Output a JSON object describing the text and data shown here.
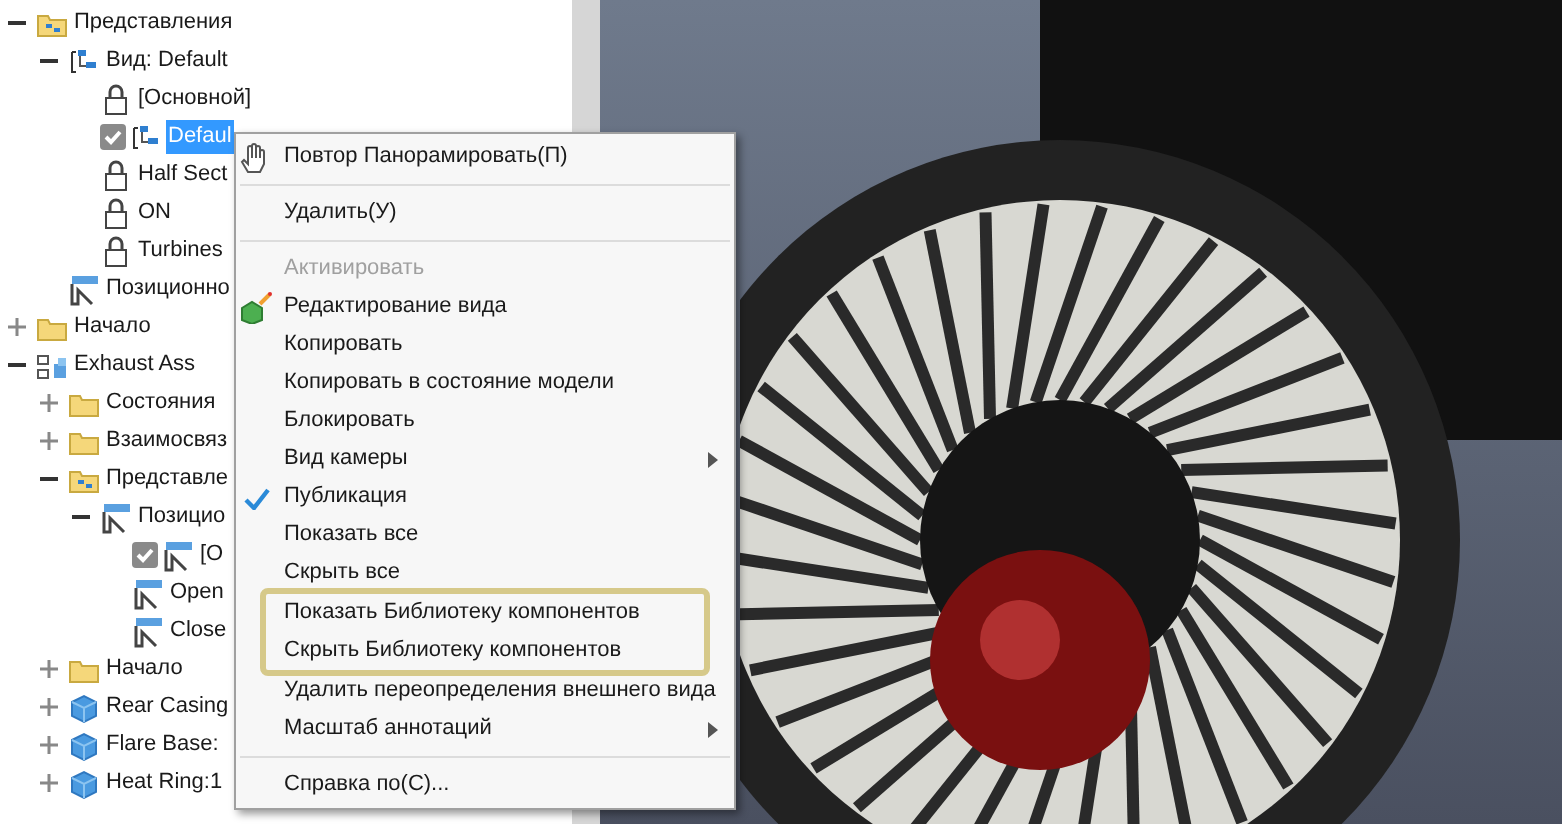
{
  "tree": [
    {
      "label": "Представления",
      "kind": "folder-view",
      "expanded": true,
      "children": [
        {
          "label": "Вид: Default",
          "kind": "view",
          "expanded": true,
          "children": [
            {
              "label": "[Основной]",
              "kind": "lock"
            },
            {
              "label": "Defaul",
              "kind": "view",
              "checked": true,
              "selected": true
            },
            {
              "label": "Half Sect",
              "kind": "lock"
            },
            {
              "label": "ON",
              "kind": "lock"
            },
            {
              "label": "Turbines",
              "kind": "lock"
            }
          ]
        },
        {
          "label": "Позиционно",
          "kind": "position"
        }
      ]
    },
    {
      "label": "Начало",
      "kind": "folder",
      "expanded": false
    },
    {
      "label": "Exhaust Ass",
      "kind": "assembly",
      "expanded": true,
      "children": [
        {
          "label": "Состояния",
          "kind": "folder",
          "expanded": false
        },
        {
          "label": "Взаимосвяз",
          "kind": "folder",
          "expanded": false
        },
        {
          "label": "Представле",
          "kind": "folder-view",
          "expanded": true,
          "children": [
            {
              "label": "Позицио",
              "kind": "position",
              "expanded": true,
              "children": [
                {
                  "label": "[O",
                  "kind": "position",
                  "checked": true
                },
                {
                  "label": "Open",
                  "kind": "position"
                },
                {
                  "label": "Close",
                  "kind": "position"
                }
              ]
            }
          ]
        },
        {
          "label": "Начало",
          "kind": "folder",
          "expanded": false
        },
        {
          "label": "Rear Casing",
          "kind": "part",
          "expanded": false
        },
        {
          "label": "Flare Base:",
          "kind": "part",
          "expanded": false
        },
        {
          "label": "Heat Ring:1",
          "kind": "part",
          "expanded": false
        }
      ]
    }
  ],
  "context_menu": [
    {
      "kind": "item",
      "label": "Повтор Панорамировать(П)"
    },
    {
      "kind": "separator"
    },
    {
      "kind": "item",
      "label": "Удалить(У)"
    },
    {
      "kind": "separator"
    },
    {
      "kind": "item",
      "label": "Активировать",
      "disabled": true
    },
    {
      "kind": "item",
      "label": "Редактирование вида"
    },
    {
      "kind": "item",
      "label": "Копировать"
    },
    {
      "kind": "item",
      "label": "Копировать в состояние модели"
    },
    {
      "kind": "item",
      "label": "Блокировать"
    },
    {
      "kind": "item",
      "label": "Вид камеры",
      "submenu": true
    },
    {
      "kind": "item",
      "label": "Публикация",
      "checked": true
    },
    {
      "kind": "item",
      "label": "Показать все"
    },
    {
      "kind": "item",
      "label": "Скрыть все"
    },
    {
      "kind": "item",
      "label": "Показать Библиотеку компонентов",
      "highlighted": true
    },
    {
      "kind": "item",
      "label": "Скрыть Библиотеку компонентов",
      "highlighted": true
    },
    {
      "kind": "item",
      "label": "Удалить переопределения внешнего вида"
    },
    {
      "kind": "item",
      "label": "Масштаб аннотаций",
      "submenu": true
    },
    {
      "kind": "separator"
    },
    {
      "kind": "item",
      "label": "Справка по(С)..."
    }
  ]
}
